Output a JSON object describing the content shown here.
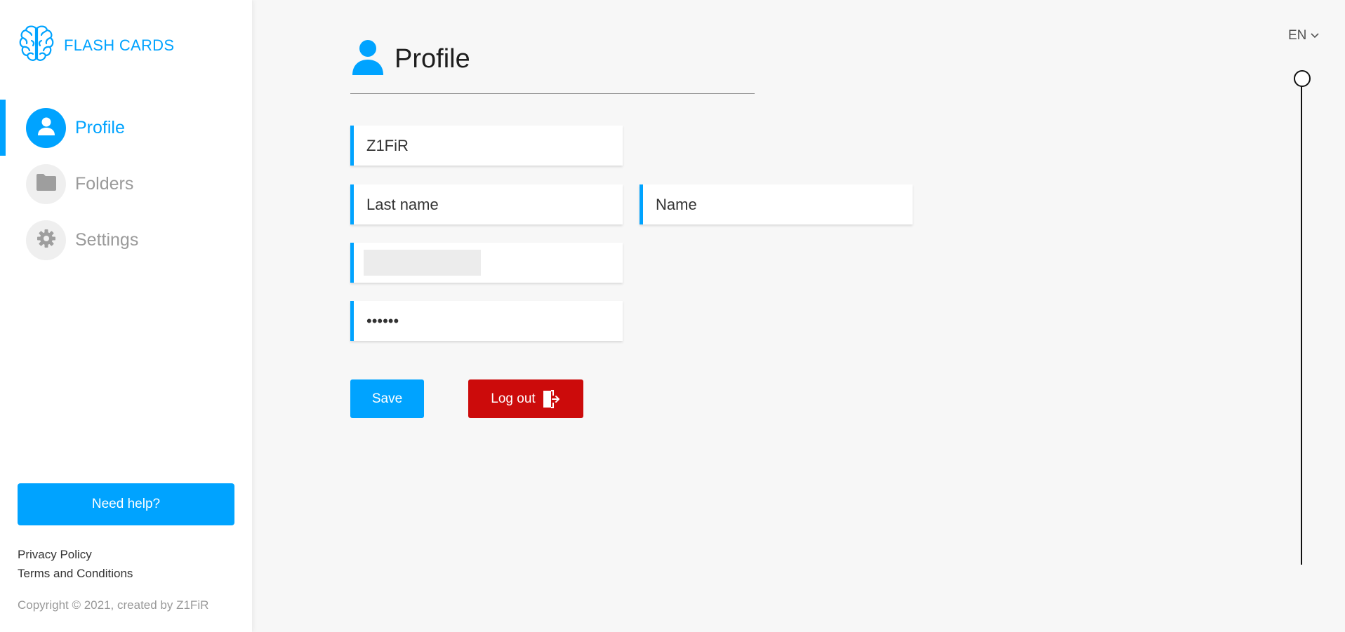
{
  "app": {
    "name": "FLASH CARDS"
  },
  "nav": {
    "items": [
      {
        "label": "Profile",
        "icon": "user-icon",
        "active": true
      },
      {
        "label": "Folders",
        "icon": "folder-icon",
        "active": false
      },
      {
        "label": "Settings",
        "icon": "gear-icon",
        "active": false
      }
    ]
  },
  "sidebar": {
    "help_label": "Need help?",
    "privacy_label": "Privacy Policy",
    "terms_label": "Terms and Conditions",
    "copyright": "Copyright © 2021, created by Z1FiR"
  },
  "page": {
    "title": "Profile",
    "title_icon": "user-icon"
  },
  "form": {
    "username_value": "Z1FiR",
    "last_name_placeholder": "Last name",
    "first_name_placeholder": "Name",
    "password_value": "••••••",
    "save_label": "Save",
    "logout_label": "Log out"
  },
  "language": {
    "selected": "EN"
  },
  "colors": {
    "accent": "#00a3ff",
    "danger": "#cc0b0b",
    "background": "#f7f7f7"
  }
}
